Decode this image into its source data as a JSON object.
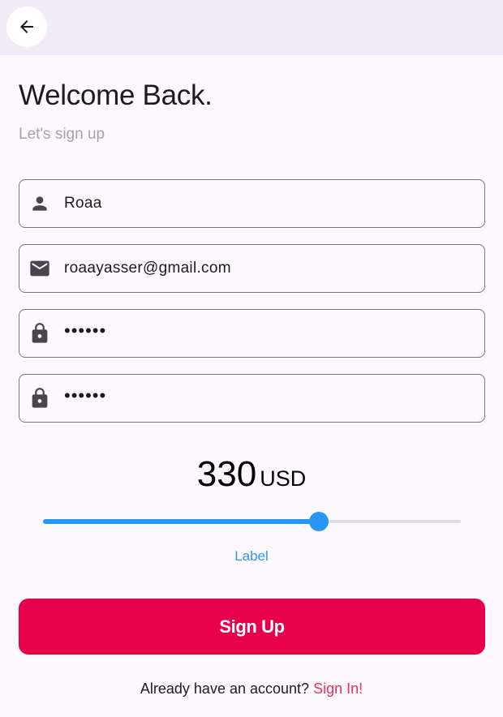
{
  "appbar": {
    "back_icon": "arrow-back-icon"
  },
  "header": {
    "title": "Welcome Back.",
    "subtitle": "Let's sign up"
  },
  "form": {
    "name": {
      "icon": "person-icon",
      "value": "Roaa"
    },
    "email": {
      "icon": "mail-icon",
      "value": "roaayasser@gmail.com"
    },
    "password": {
      "icon": "lock-icon",
      "value": "••••••"
    },
    "confirm_password": {
      "icon": "lock-icon",
      "value": "••••••"
    }
  },
  "price": {
    "amount": "330",
    "currency": "USD",
    "slider_fraction": 0.66,
    "slider_label": "Label"
  },
  "actions": {
    "signup_label": "Sign Up",
    "footer_text": "Already have an account?",
    "signin_label": "Sign In!"
  },
  "colors": {
    "accent": "#e8004c",
    "slider": "#2a96f3",
    "link": "#e8305a"
  }
}
